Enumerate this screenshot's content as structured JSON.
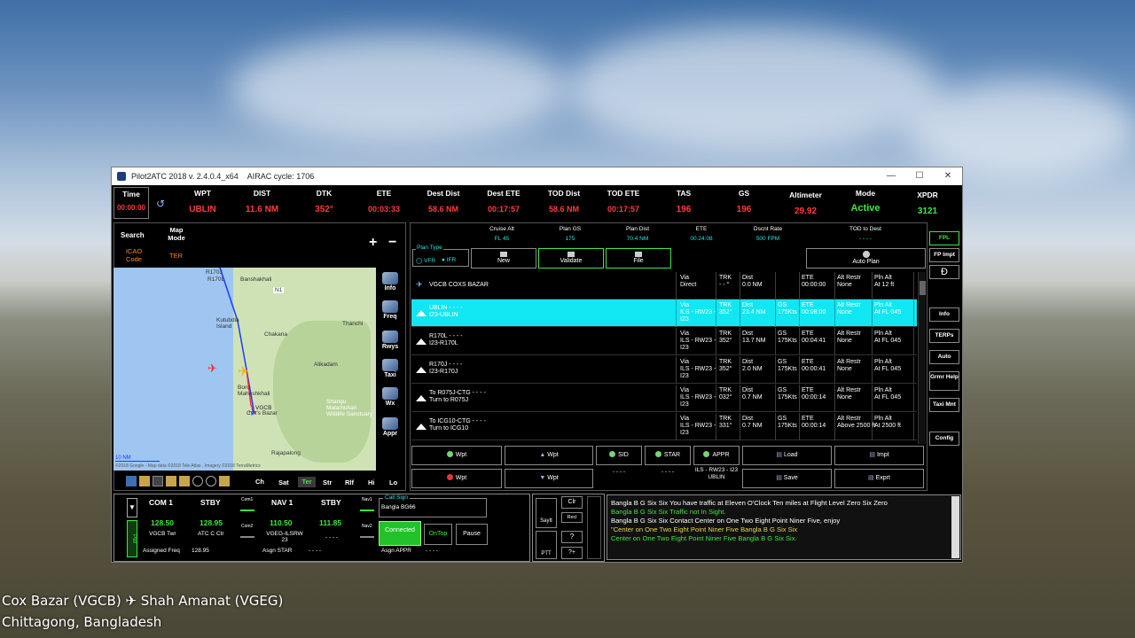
{
  "window": {
    "title": "Pilot2ATC 2018 v. 2.4.0.4_x64",
    "airac": "AIRAC cycle: 1706"
  },
  "header": {
    "time_label": "Time",
    "time_value": "00:00:00",
    "wpt_label": "WPT",
    "wpt_value": "UBLIN",
    "dist_label": "DIST",
    "dist_value": "11.6 NM",
    "dtk_label": "DTK",
    "dtk_value": "352°",
    "ete_label": "ETE",
    "ete_value": "00:03:33",
    "destdist_label": "Dest Dist",
    "destdist_value": "58.6 NM",
    "destete_label": "Dest ETE",
    "destete_value": "00:17:57",
    "toddist_label": "TOD Dist",
    "toddist_value": "58.6 NM",
    "todete_label": "TOD ETE",
    "todete_value": "00:17:57",
    "tas_label": "TAS",
    "tas_value": "196",
    "gs_label": "GS",
    "gs_value": "196",
    "alt_label": "Altimeter",
    "alt_value": "29.92",
    "mode_label": "Mode",
    "mode_value": "Active",
    "xpdr_label": "XPDR",
    "xpdr_value": "3121"
  },
  "map_panel": {
    "search_label": "Search",
    "map_mode_label": "Map Mode",
    "icao_label": "ICAO Code",
    "ter_label": "TER",
    "labels": [
      "R170J",
      "R170L",
      "Banshakhali",
      "Kutubdia Island",
      "Chakaria",
      "Thanchi",
      "Alikadam",
      "Boro Maheshkhali",
      "VGCB",
      "Cox's Bazar",
      "Shangu Matamuhari Wildlife Sanctuary",
      "Rajapalong",
      "N1"
    ],
    "scale": "10 NM",
    "credit": "©2018 Google - Map data ©2018 Tele Atlas , Imagery ©2018 TerraMetrics",
    "side_buttons": [
      "Info",
      "Freq",
      "Rwys",
      "Taxi",
      "Wx",
      "Appr"
    ],
    "mode_tabs": [
      "Ch",
      "Sat",
      "Ter",
      "Str",
      "Rlf",
      "Hi",
      "Lo"
    ]
  },
  "plan": {
    "cruise_alt_label": "Cruise Alt",
    "cruise_alt": "FL 45",
    "plan_gs_label": "Plan GS",
    "plan_gs": "175",
    "plan_dist_label": "Plan Dist",
    "plan_dist": "70.4 NM",
    "ete_label": "ETE",
    "ete": "00:24:08",
    "dscnt_label": "Dscnt Rate",
    "dscnt": "500 FPM",
    "tod_label": "TOD to Dest",
    "tod": "- - - -",
    "plan_type_label": "Plan Type",
    "vfr": "VFR",
    "ifr": "IFR",
    "new_label": "New",
    "validate_label": "Validate",
    "file_label": "File",
    "auto_plan_label": "Auto Plan"
  },
  "rows": [
    {
      "name": "VGCB   COXS BAZAR",
      "sub": "",
      "via": "Via",
      "via2": "Direct",
      "via3": "",
      "trk": "TRK",
      "trk2": "- - °",
      "dist": "Dist",
      "dist2": "0.0 NM",
      "gs": "",
      "gs2": "",
      "ete": "ETE",
      "ete2": "00:00:00",
      "rest": "Alt Restr",
      "rest2": "None",
      "pln": "Pln Alt",
      "pln2": "At 12 ft"
    },
    {
      "name": "UBLIN   - - - -",
      "sub": "I23-UBLIN",
      "via": "Via",
      "via2": "ILS - RW23 -",
      "via3": "I23",
      "trk": "TRK",
      "trk2": "352°",
      "dist": "Dist",
      "dist2": "23.4 NM",
      "gs": "GS",
      "gs2": "175Kts",
      "ete": "ETE",
      "ete2": "00:08:00",
      "rest": "Alt Restr",
      "rest2": "None",
      "pln": "Pln Alt",
      "pln2": "At FL 045"
    },
    {
      "name": "R170L   - - - -",
      "sub": "I23-R170L",
      "via": "Via",
      "via2": "ILS - RW23 -",
      "via3": "I23",
      "trk": "TRK",
      "trk2": "352°",
      "dist": "Dist",
      "dist2": "13.7 NM",
      "gs": "GS",
      "gs2": "175Kts",
      "ete": "ETE",
      "ete2": "00:04:41",
      "rest": "Alt Restr",
      "rest2": "None",
      "pln": "Pln Alt",
      "pln2": "At FL 045"
    },
    {
      "name": "R170J   - - - -",
      "sub": "I23-R170J",
      "via": "Via",
      "via2": "ILS - RW23 -",
      "via3": "I23",
      "trk": "TRK",
      "trk2": "352°",
      "dist": "Dist",
      "dist2": "2.0 NM",
      "gs": "GS",
      "gs2": "175Kts",
      "ete": "ETE",
      "ete2": "00:00:41",
      "rest": "Alt Restr",
      "rest2": "None",
      "pln": "Pln Alt",
      "pln2": "At FL 045"
    },
    {
      "name": "To R075J-CTG   - - - -",
      "sub": "Turn to R075J",
      "via": "Via",
      "via2": "ILS - RW23 -",
      "via3": "I23",
      "trk": "TRK",
      "trk2": "032°",
      "dist": "Dist",
      "dist2": "0.7 NM",
      "gs": "GS",
      "gs2": "175Kts",
      "ete": "ETE",
      "ete2": "00:00:14",
      "rest": "Alt Restr",
      "rest2": "None",
      "pln": "Pln Alt",
      "pln2": "At FL 045"
    },
    {
      "name": "To ICG10-CTG   - - - -",
      "sub": "Turn to ICG10",
      "via": "Via",
      "via2": "ILS - RW23 -",
      "via3": "I23",
      "trk": "TRK",
      "trk2": "331°",
      "dist": "Dist",
      "dist2": "0.7 NM",
      "gs": "GS",
      "gs2": "175Kts",
      "ete": "ETE",
      "ete2": "00:00:14",
      "rest": "Alt Restr",
      "rest2": "Above 2500 ft",
      "pln": "Pln Alt",
      "pln2": "At 2500 ft"
    }
  ],
  "plan_buttons": {
    "wpt_add": "Wpt",
    "wpt_up": "Wpt",
    "sid": "SID",
    "star": "STAR",
    "appr": "APPR",
    "load": "Load",
    "impt": "Impt",
    "wpt_del": "Wpt",
    "wpt_down": "Wpt",
    "sid_val": "- - - -",
    "star_val": "- - - -",
    "appr_val": "ILS - RW23 - I23 UBLIN",
    "save": "Save",
    "exprt": "Exprt"
  },
  "right_buttons": [
    "FPL",
    "FP Impt",
    "Info",
    "TERPs",
    "Auto",
    "Grmr Help",
    "Taxi Mnt",
    "Config"
  ],
  "radio": {
    "com1_label": "COM 1",
    "com1": "128.50",
    "com1_name": "VGCB Twr",
    "stby1_label": "STBY",
    "stby1": "128.95",
    "stby1_name": "ATC C Ctr",
    "nav1_label": "NAV 1",
    "nav1": "110.50",
    "nav1_name": "VGEG-ILSRW 23",
    "stby2_label": "STBY",
    "stby2": "111.85",
    "stby2_name": "- - - -",
    "com1_small": "Com1",
    "com2_small": "Com2",
    "nav1_small": "Nav1",
    "nav2_small": "Nav2",
    "pwr": "Pwr",
    "assigned_freq_label": "Assigned Freq",
    "assigned_freq": "128.95",
    "asgn_star_label": "Asgn STAR",
    "asgn_star": "- - - -",
    "asgn_appr_label": "Asgn APPR",
    "asgn_appr": "- - - -",
    "callsign_label": "Call Sign",
    "callsign": "Bangla BG66",
    "connected": "Connected",
    "ontop": "OnTop",
    "pause": "Pause"
  },
  "controls": {
    "sayit": "SayIt",
    "ptt": "PTT",
    "clr": "Clr",
    "recl": "Recl",
    "q": "?",
    "qplus": "?+"
  },
  "messages": [
    {
      "text": "Bangla B G Six Six You have traffic at Eleven O'Clock  Ten miles at Flight Level Zero Six Zero",
      "color": "#ffffff"
    },
    {
      "text": " Bangla B G Six Six Traffic not In Sight.",
      "color": "#3ee83e"
    },
    {
      "text": "Bangla B G Six Six Contact Center on One Two Eight Point Niner Five,  enjoy",
      "color": "#ffffff"
    },
    {
      "text": "\"Center on One Two Eight Point Niner Five Bangla B G Six Six",
      "color": "#e6d84a"
    },
    {
      "text": " Center on One Two Eight Point Niner Five Bangla B G Six Six.",
      "color": "#3ee83e"
    }
  ],
  "caption": {
    "line1": "Cox Bazar (VGCB) ✈ Shah Amanat  (VGEG)",
    "line2": "Chittagong, Bangladesh"
  }
}
